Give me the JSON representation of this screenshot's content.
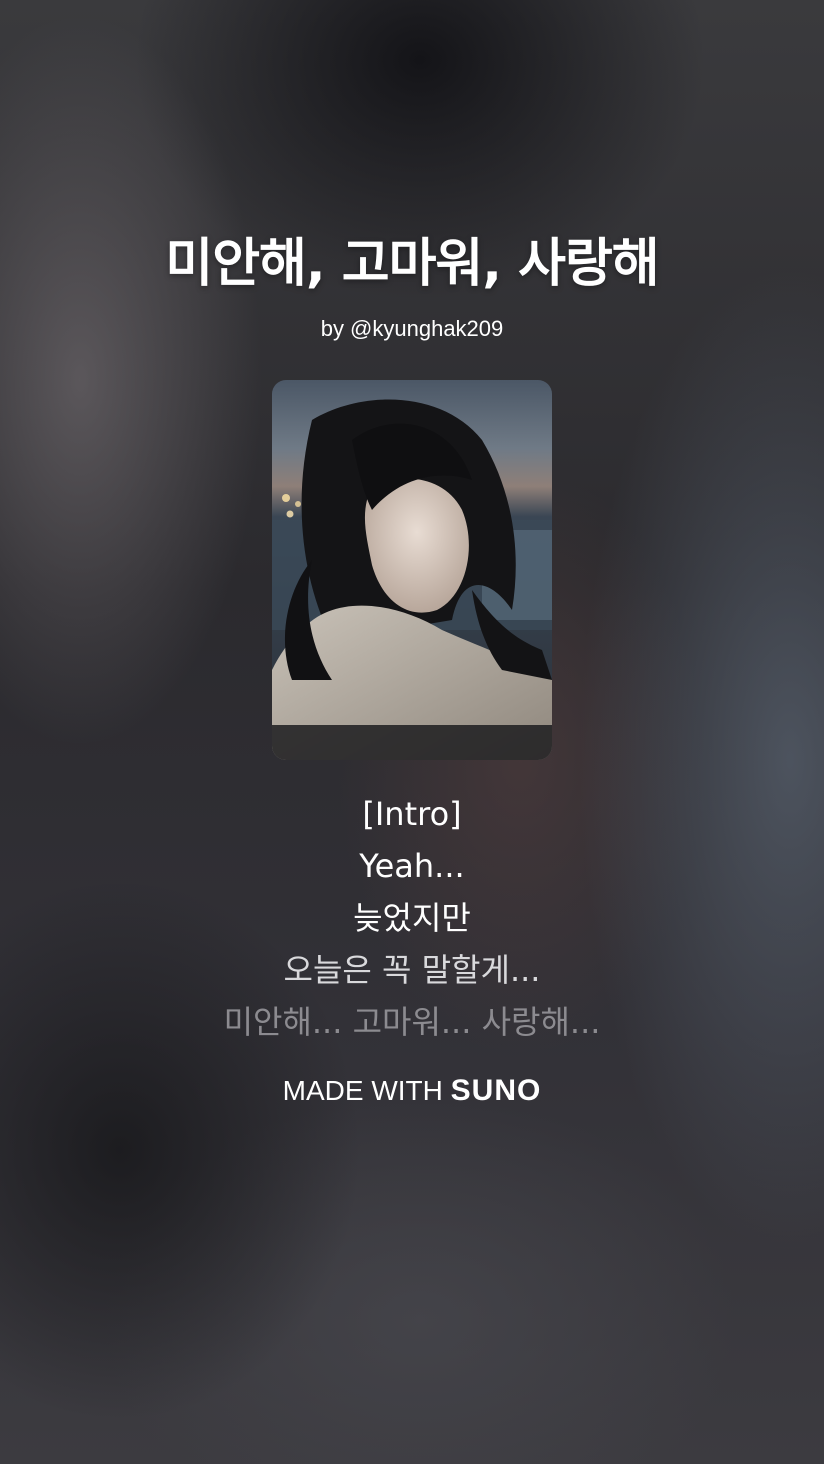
{
  "song": {
    "title": "미안해, 고마워, 사랑해",
    "byline": "by @kyunghak209"
  },
  "cover": {
    "icon": "cover-art-image"
  },
  "lyrics": [
    {
      "text": "[Intro]",
      "color": "#ffffff"
    },
    {
      "text": "Yeah...",
      "color": "#ffffff"
    },
    {
      "text": "늦었지만",
      "color": "#ffffff"
    },
    {
      "text": "오늘은 꼭 말할게...",
      "color": "#d9d9dc"
    },
    {
      "text": "미안해... 고마워... 사랑해...",
      "color": "#8c8b90"
    }
  ],
  "footer": {
    "made_with": "MADE WITH",
    "brand": "SUNO"
  }
}
